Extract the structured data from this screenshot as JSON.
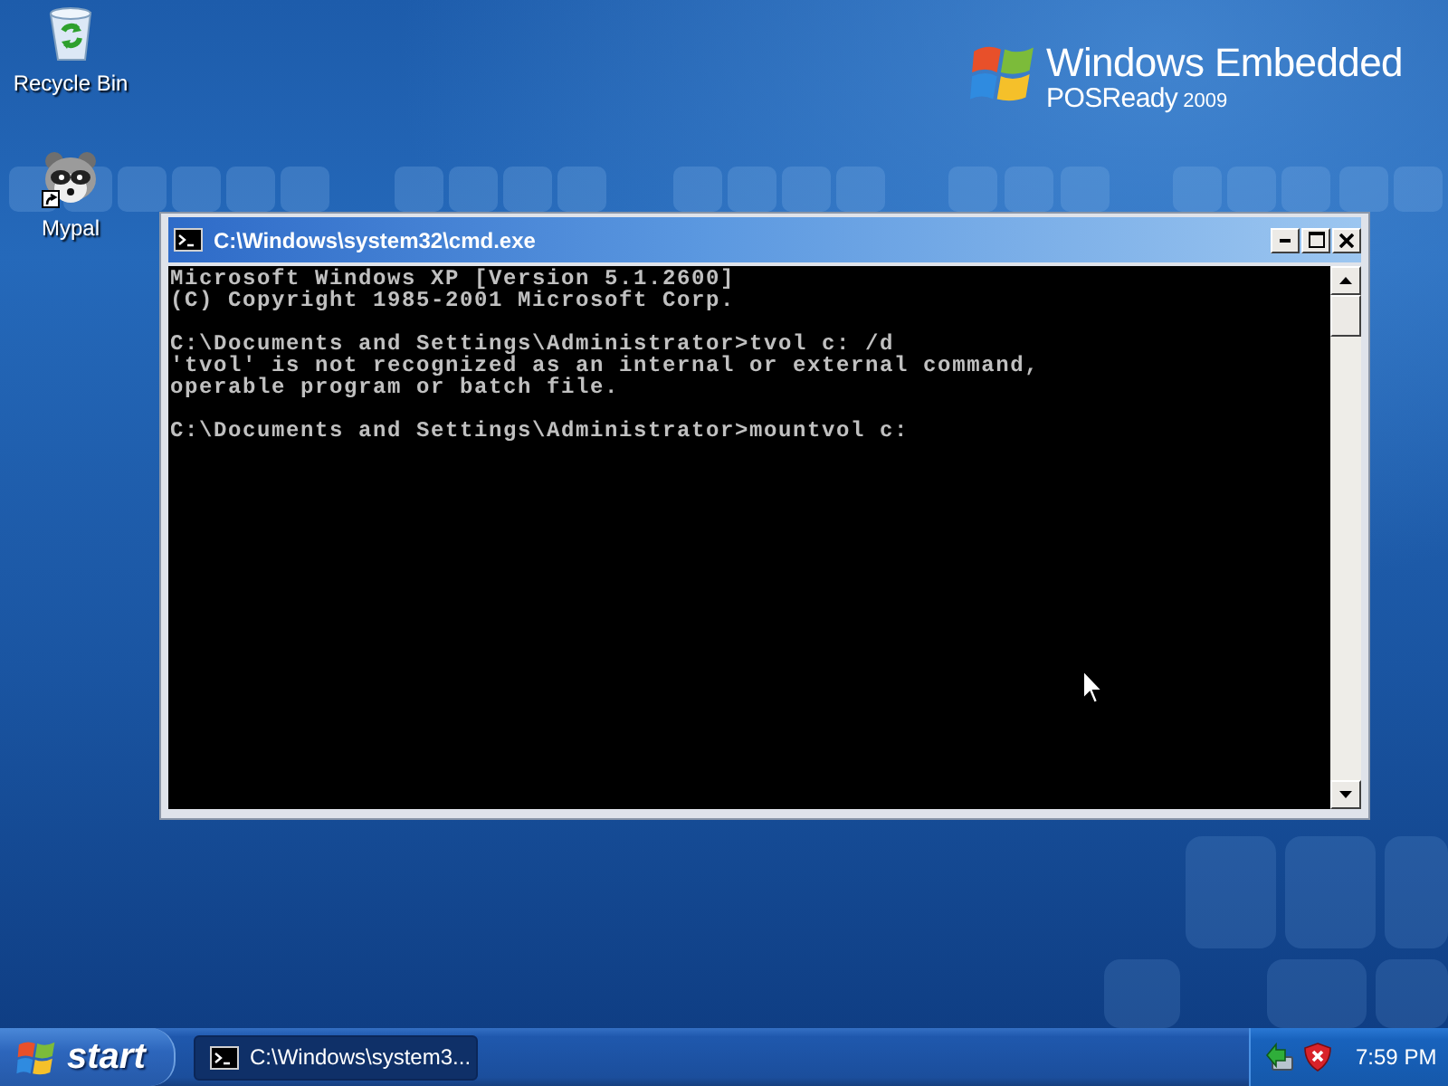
{
  "desktop": {
    "icons": [
      {
        "label": "Recycle Bin",
        "kind": "recycle-bin"
      },
      {
        "label": "Mypal",
        "kind": "app-shortcut"
      }
    ]
  },
  "branding": {
    "name": "Windows Embedded",
    "edition": "POSReady",
    "year": "2009"
  },
  "console_window": {
    "title": "C:\\Windows\\system32\\cmd.exe",
    "output": [
      [
        "Microsoft Windows XP [Version 5.1.2600]",
        "(C) Copyright 1985-2001 Microsoft Corp."
      ],
      [
        "C:\\Documents and Settings\\Administrator>tvol c: /d",
        "'tvol' is not recognized as an internal or external command,",
        "operable program or batch file."
      ],
      [
        "C:\\Documents and Settings\\Administrator>mountvol c:"
      ]
    ]
  },
  "taskbar": {
    "start_label": "start",
    "tasks": [
      {
        "label": "C:\\Windows\\system3...",
        "selected": true
      }
    ],
    "clock": "7:59 PM"
  }
}
